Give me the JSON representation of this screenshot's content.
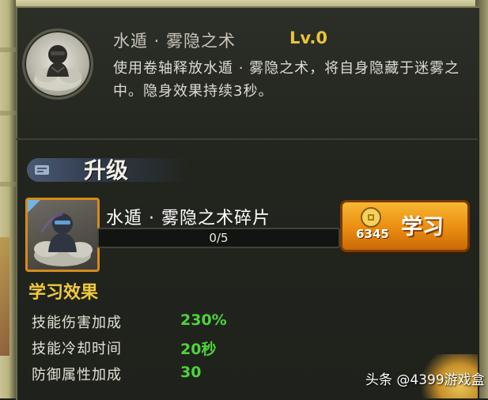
{
  "skill": {
    "name": "水遁 · 雾隐之术",
    "level": "Lv.0",
    "description": "使用卷轴释放水遁 · 雾隐之术，将自身隐藏于迷雾之中。隐身效果持续3秒。",
    "icon": "ninja-smoke-icon"
  },
  "upgrade": {
    "label": "升级",
    "icon": "scroll-tab-icon"
  },
  "fragment": {
    "name": "水遁 · 雾隐之术碎片",
    "progress_text": "0/5",
    "progress_current": 0,
    "progress_max": 5,
    "icon": "ninja-fragment-icon"
  },
  "learn_button": {
    "label": "学习",
    "cost": "6345",
    "cost_icon": "coin-icon"
  },
  "effects": {
    "title": "学习效果",
    "rows": [
      {
        "label": "技能伤害加成",
        "value": "230%"
      },
      {
        "label": "技能冷却时间",
        "value": "20秒"
      },
      {
        "label": "防御属性加成",
        "value": "30"
      }
    ]
  },
  "watermark": "头条 @4399游戏盒",
  "colors": {
    "level": "#e9c53b",
    "effects_title": "#f0c93f",
    "effect_value": "#4fd33b",
    "button": "#ea8c10",
    "panel": "#262a22"
  }
}
